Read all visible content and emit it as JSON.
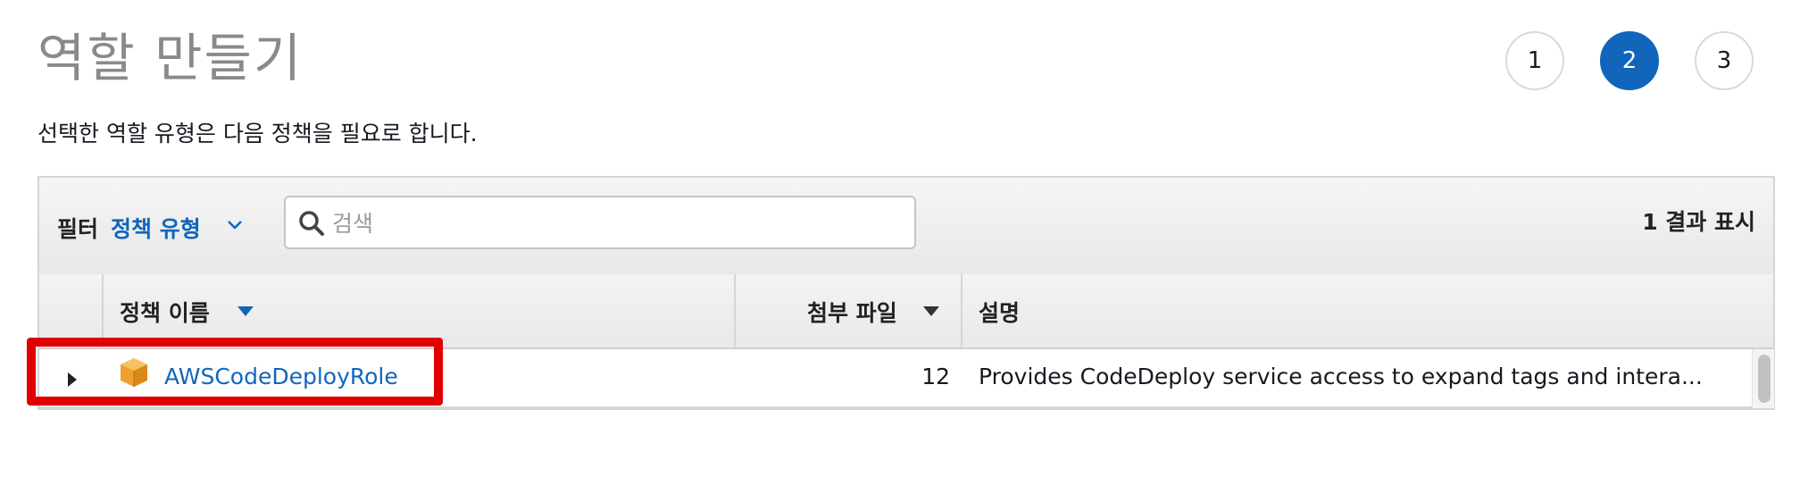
{
  "page": {
    "title": "역할 만들기",
    "subtitle": "선택한 역할 유형은 다음 정책을 필요로 합니다."
  },
  "wizard": {
    "steps": [
      "1",
      "2",
      "3"
    ],
    "active_step": "2"
  },
  "filter": {
    "label": "필터",
    "type_label": "정책 유형",
    "search_placeholder": "검색",
    "result_count": "1 결과 표시"
  },
  "table": {
    "columns": {
      "policy_name": "정책 이름",
      "attachments": "첨부 파일",
      "description": "설명"
    },
    "rows": [
      {
        "name": "AWSCodeDeployRole",
        "attachments": "12",
        "description": "Provides CodeDeploy service access to expand tags and intera..."
      }
    ]
  },
  "colors": {
    "accent": "#1166bb",
    "highlight": "#e00000",
    "package_icon": "#f0a030"
  }
}
